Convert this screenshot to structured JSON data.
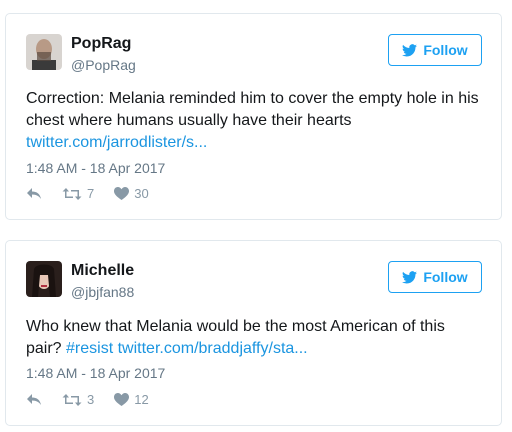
{
  "colors": {
    "accent": "#1da1f2",
    "link": "#1b95e0",
    "muted": "#657786",
    "border": "#e1e8ed"
  },
  "tweets": [
    {
      "name": "PopRag",
      "handle": "@PopRag",
      "follow_label": "Follow",
      "text": "Correction: Melania reminded him to cover the empty hole in his chest where humans usually have their hearts",
      "link": "twitter.com/jarrodlister/s...",
      "hashtag": "",
      "timestamp": "1:48 AM - 18 Apr 2017",
      "retweets": "7",
      "likes": "30"
    },
    {
      "name": "Michelle",
      "handle": "@jbjfan88",
      "follow_label": "Follow",
      "text": "Who knew that Melania would be the most American of this pair?",
      "hashtag": "#resist",
      "link": "twitter.com/braddjaffy/sta...",
      "timestamp": "1:48 AM - 18 Apr 2017",
      "retweets": "3",
      "likes": "12"
    }
  ]
}
